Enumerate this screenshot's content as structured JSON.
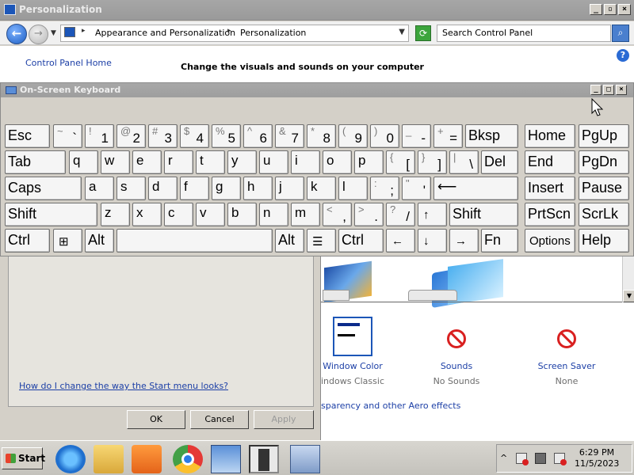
{
  "window": {
    "title": "Personalization"
  },
  "address": {
    "crumbs": [
      "Appearance and Personalization",
      "Personalization"
    ],
    "search_placeholder": "Search Control Panel"
  },
  "content": {
    "cp_home": "Control Panel Home",
    "headline": "Change the visuals and sounds on your computer"
  },
  "dialog": {
    "link": "How do I change the way the Start menu looks?",
    "ok": "OK",
    "cancel": "Cancel",
    "apply": "Apply"
  },
  "options": [
    {
      "label": "Window Color",
      "sub": "indows Classic",
      "icon": "window-color-icon"
    },
    {
      "label": "Sounds",
      "sub": "No Sounds",
      "icon": "sounds-icon"
    },
    {
      "label": "Screen Saver",
      "sub": "None",
      "icon": "screen-saver-icon"
    }
  ],
  "aero_link": "sparency and other Aero effects",
  "osk": {
    "title": "On-Screen Keyboard"
  },
  "keys": {
    "esc": "Esc",
    "tilde_top": "~",
    "tilde_bot": "`",
    "n1_top": "!",
    "n1": "1",
    "n2_top": "@",
    "n2": "2",
    "n3_top": "#",
    "n3": "3",
    "n4_top": "$",
    "n4": "4",
    "n5_top": "%",
    "n5": "5",
    "n6_top": "^",
    "n6": "6",
    "n7_top": "&",
    "n7": "7",
    "n8_top": "*",
    "n8": "8",
    "n9_top": "(",
    "n9": "9",
    "n0_top": ")",
    "n0": "0",
    "minus_top": "_",
    "minus": "-",
    "eq_top": "+",
    "eq": "=",
    "bksp": "Bksp",
    "home": "Home",
    "pgup": "PgUp",
    "tab": "Tab",
    "q": "q",
    "w": "w",
    "e": "e",
    "r": "r",
    "t": "t",
    "y": "y",
    "u": "u",
    "i": "i",
    "o": "o",
    "p": "p",
    "lbr_top": "{",
    "lbr": "[",
    "rbr_top": "}",
    "rbr": "]",
    "bsl_top": "|",
    "bsl": "\\",
    "del": "Del",
    "end": "End",
    "pgdn": "PgDn",
    "caps": "Caps",
    "a": "a",
    "s": "s",
    "d": "d",
    "f": "f",
    "g": "g",
    "h": "h",
    "j": "j",
    "k": "k",
    "l": "l",
    "semi_top": ":",
    "semi": ";",
    "quote_top": "\"",
    "quote": "'",
    "enter": "⟵",
    "insert": "Insert",
    "pause": "Pause",
    "shift": "Shift",
    "z": "z",
    "x": "x",
    "c": "c",
    "v": "v",
    "b": "b",
    "n": "n",
    "m": "m",
    "comma_top": "<",
    "comma": ",",
    "dot_top": ">",
    "dot": ".",
    "slash_top": "?",
    "slash": "/",
    "up": "↑",
    "shift_r": "Shift",
    "prtscn": "PrtScn",
    "scrlk": "ScrLk",
    "ctrl": "Ctrl",
    "win": "⊞",
    "alt": "Alt",
    "alt_r": "Alt",
    "menu": "☰",
    "ctrl_r": "Ctrl",
    "left": "←",
    "down": "↓",
    "right": "→",
    "fn": "Fn",
    "options": "Options",
    "help": "Help"
  },
  "taskbar": {
    "start": "Start",
    "time": "6:29 PM",
    "date": "11/5/2023"
  }
}
